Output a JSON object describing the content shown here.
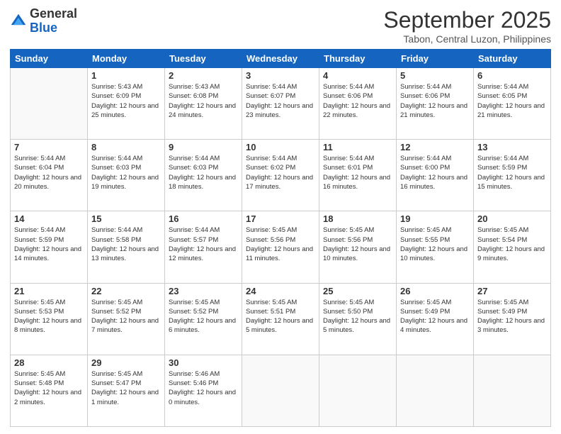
{
  "logo": {
    "general": "General",
    "blue": "Blue"
  },
  "header": {
    "month": "September 2025",
    "location": "Tabon, Central Luzon, Philippines"
  },
  "days_of_week": [
    "Sunday",
    "Monday",
    "Tuesday",
    "Wednesday",
    "Thursday",
    "Friday",
    "Saturday"
  ],
  "weeks": [
    [
      {
        "day": "",
        "sunrise": "",
        "sunset": "",
        "daylight": ""
      },
      {
        "day": "1",
        "sunrise": "Sunrise: 5:43 AM",
        "sunset": "Sunset: 6:09 PM",
        "daylight": "Daylight: 12 hours and 25 minutes."
      },
      {
        "day": "2",
        "sunrise": "Sunrise: 5:43 AM",
        "sunset": "Sunset: 6:08 PM",
        "daylight": "Daylight: 12 hours and 24 minutes."
      },
      {
        "day": "3",
        "sunrise": "Sunrise: 5:44 AM",
        "sunset": "Sunset: 6:07 PM",
        "daylight": "Daylight: 12 hours and 23 minutes."
      },
      {
        "day": "4",
        "sunrise": "Sunrise: 5:44 AM",
        "sunset": "Sunset: 6:06 PM",
        "daylight": "Daylight: 12 hours and 22 minutes."
      },
      {
        "day": "5",
        "sunrise": "Sunrise: 5:44 AM",
        "sunset": "Sunset: 6:06 PM",
        "daylight": "Daylight: 12 hours and 21 minutes."
      },
      {
        "day": "6",
        "sunrise": "Sunrise: 5:44 AM",
        "sunset": "Sunset: 6:05 PM",
        "daylight": "Daylight: 12 hours and 21 minutes."
      }
    ],
    [
      {
        "day": "7",
        "sunrise": "Sunrise: 5:44 AM",
        "sunset": "Sunset: 6:04 PM",
        "daylight": "Daylight: 12 hours and 20 minutes."
      },
      {
        "day": "8",
        "sunrise": "Sunrise: 5:44 AM",
        "sunset": "Sunset: 6:03 PM",
        "daylight": "Daylight: 12 hours and 19 minutes."
      },
      {
        "day": "9",
        "sunrise": "Sunrise: 5:44 AM",
        "sunset": "Sunset: 6:03 PM",
        "daylight": "Daylight: 12 hours and 18 minutes."
      },
      {
        "day": "10",
        "sunrise": "Sunrise: 5:44 AM",
        "sunset": "Sunset: 6:02 PM",
        "daylight": "Daylight: 12 hours and 17 minutes."
      },
      {
        "day": "11",
        "sunrise": "Sunrise: 5:44 AM",
        "sunset": "Sunset: 6:01 PM",
        "daylight": "Daylight: 12 hours and 16 minutes."
      },
      {
        "day": "12",
        "sunrise": "Sunrise: 5:44 AM",
        "sunset": "Sunset: 6:00 PM",
        "daylight": "Daylight: 12 hours and 16 minutes."
      },
      {
        "day": "13",
        "sunrise": "Sunrise: 5:44 AM",
        "sunset": "Sunset: 5:59 PM",
        "daylight": "Daylight: 12 hours and 15 minutes."
      }
    ],
    [
      {
        "day": "14",
        "sunrise": "Sunrise: 5:44 AM",
        "sunset": "Sunset: 5:59 PM",
        "daylight": "Daylight: 12 hours and 14 minutes."
      },
      {
        "day": "15",
        "sunrise": "Sunrise: 5:44 AM",
        "sunset": "Sunset: 5:58 PM",
        "daylight": "Daylight: 12 hours and 13 minutes."
      },
      {
        "day": "16",
        "sunrise": "Sunrise: 5:44 AM",
        "sunset": "Sunset: 5:57 PM",
        "daylight": "Daylight: 12 hours and 12 minutes."
      },
      {
        "day": "17",
        "sunrise": "Sunrise: 5:45 AM",
        "sunset": "Sunset: 5:56 PM",
        "daylight": "Daylight: 12 hours and 11 minutes."
      },
      {
        "day": "18",
        "sunrise": "Sunrise: 5:45 AM",
        "sunset": "Sunset: 5:56 PM",
        "daylight": "Daylight: 12 hours and 10 minutes."
      },
      {
        "day": "19",
        "sunrise": "Sunrise: 5:45 AM",
        "sunset": "Sunset: 5:55 PM",
        "daylight": "Daylight: 12 hours and 10 minutes."
      },
      {
        "day": "20",
        "sunrise": "Sunrise: 5:45 AM",
        "sunset": "Sunset: 5:54 PM",
        "daylight": "Daylight: 12 hours and 9 minutes."
      }
    ],
    [
      {
        "day": "21",
        "sunrise": "Sunrise: 5:45 AM",
        "sunset": "Sunset: 5:53 PM",
        "daylight": "Daylight: 12 hours and 8 minutes."
      },
      {
        "day": "22",
        "sunrise": "Sunrise: 5:45 AM",
        "sunset": "Sunset: 5:52 PM",
        "daylight": "Daylight: 12 hours and 7 minutes."
      },
      {
        "day": "23",
        "sunrise": "Sunrise: 5:45 AM",
        "sunset": "Sunset: 5:52 PM",
        "daylight": "Daylight: 12 hours and 6 minutes."
      },
      {
        "day": "24",
        "sunrise": "Sunrise: 5:45 AM",
        "sunset": "Sunset: 5:51 PM",
        "daylight": "Daylight: 12 hours and 5 minutes."
      },
      {
        "day": "25",
        "sunrise": "Sunrise: 5:45 AM",
        "sunset": "Sunset: 5:50 PM",
        "daylight": "Daylight: 12 hours and 5 minutes."
      },
      {
        "day": "26",
        "sunrise": "Sunrise: 5:45 AM",
        "sunset": "Sunset: 5:49 PM",
        "daylight": "Daylight: 12 hours and 4 minutes."
      },
      {
        "day": "27",
        "sunrise": "Sunrise: 5:45 AM",
        "sunset": "Sunset: 5:49 PM",
        "daylight": "Daylight: 12 hours and 3 minutes."
      }
    ],
    [
      {
        "day": "28",
        "sunrise": "Sunrise: 5:45 AM",
        "sunset": "Sunset: 5:48 PM",
        "daylight": "Daylight: 12 hours and 2 minutes."
      },
      {
        "day": "29",
        "sunrise": "Sunrise: 5:45 AM",
        "sunset": "Sunset: 5:47 PM",
        "daylight": "Daylight: 12 hours and 1 minute."
      },
      {
        "day": "30",
        "sunrise": "Sunrise: 5:46 AM",
        "sunset": "Sunset: 5:46 PM",
        "daylight": "Daylight: 12 hours and 0 minutes."
      },
      {
        "day": "",
        "sunrise": "",
        "sunset": "",
        "daylight": ""
      },
      {
        "day": "",
        "sunrise": "",
        "sunset": "",
        "daylight": ""
      },
      {
        "day": "",
        "sunrise": "",
        "sunset": "",
        "daylight": ""
      },
      {
        "day": "",
        "sunrise": "",
        "sunset": "",
        "daylight": ""
      }
    ]
  ]
}
